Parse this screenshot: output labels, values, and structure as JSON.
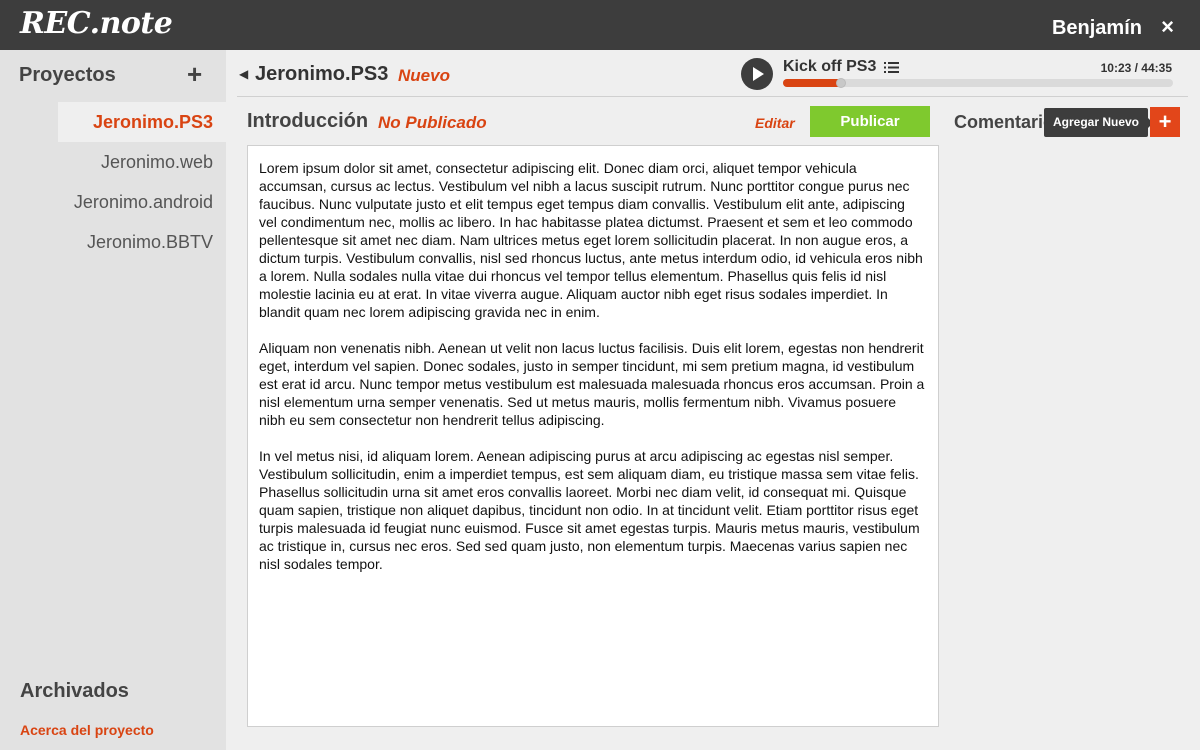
{
  "app": {
    "logo": "REC.note"
  },
  "header": {
    "user_name": "Benjamín",
    "close_label": "×"
  },
  "sidebar": {
    "title": "Proyectos",
    "add_label": "+",
    "items": [
      {
        "label": "Jeronimo.PS3",
        "active": true
      },
      {
        "label": "Jeronimo.web",
        "active": false
      },
      {
        "label": "Jeronimo.android",
        "active": false
      },
      {
        "label": "Jeronimo.BBTV",
        "active": false
      }
    ],
    "archived_label": "Archivados",
    "about_label": "Acerca del proyecto"
  },
  "project": {
    "back_icon": "◀",
    "title": "Jeronimo.PS3",
    "status": "Nuevo"
  },
  "player": {
    "track_title": "Kick off PS3",
    "time_readout": "10:23 / 44:35",
    "progress_fraction": 0.15,
    "accent": "#d94412"
  },
  "section": {
    "title": "Introducción",
    "status": "No Publicado",
    "edit_label": "Editar",
    "publish_label": "Publicar"
  },
  "comments": {
    "title": "Comentarios",
    "tooltip": "Agregar Nuevo",
    "add_label": "+"
  },
  "document": {
    "paragraphs": [
      "Lorem ipsum dolor sit amet, consectetur adipiscing elit. Donec diam orci, aliquet tempor vehicula accumsan, cursus ac lectus. Vestibulum vel nibh a lacus suscipit rutrum. Nunc porttitor congue purus nec faucibus. Nunc vulputate justo et elit tempus eget tempus diam convallis. Vestibulum elit ante, adipiscing vel condimentum nec, mollis ac libero. In hac habitasse platea dictumst. Praesent et sem et leo commodo pellentesque sit amet nec diam. Nam ultrices metus eget lorem sollicitudin placerat. In non augue eros, a dictum turpis. Vestibulum convallis, nisl sed rhoncus luctus, ante metus interdum odio, id vehicula eros nibh a lorem. Nulla sodales nulla vitae dui rhoncus vel tempor tellus elementum. Phasellus quis felis id nisl molestie lacinia eu at erat. In vitae viverra augue. Aliquam auctor nibh eget risus sodales imperdiet. In blandit quam nec lorem adipiscing gravida nec in enim.",
      "Aliquam non venenatis nibh. Aenean ut velit non lacus luctus facilisis. Duis elit lorem, egestas non hendrerit eget, interdum vel sapien. Donec sodales, justo in semper tincidunt, mi sem pretium magna, id vestibulum est erat id arcu. Nunc tempor metus vestibulum est malesuada malesuada rhoncus eros accumsan. Proin a nisl elementum urna semper venenatis. Sed ut metus mauris, mollis fermentum nibh. Vivamus posuere nibh eu sem consectetur non hendrerit tellus adipiscing.",
      "In vel metus nisi, id aliquam lorem. Aenean adipiscing purus at arcu adipiscing ac egestas nisl semper. Vestibulum sollicitudin, enim a imperdiet tempus, est sem aliquam diam, eu tristique massa sem vitae felis. Phasellus sollicitudin urna sit amet eros convallis laoreet. Morbi nec diam velit, id consequat mi. Quisque quam sapien, tristique non aliquet dapibus, tincidunt non odio. In at tincidunt velit. Etiam porttitor risus eget turpis malesuada id feugiat nunc euismod. Fusce sit amet egestas turpis. Mauris metus mauris, vestibulum ac tristique in, cursus nec eros. Sed sed quam justo, non elementum turpis. Maecenas varius sapien nec nisl sodales tempor."
    ]
  },
  "icons": {
    "play": "play-icon",
    "list": "list-icon",
    "close": "close-icon",
    "back": "back-arrow-icon"
  }
}
